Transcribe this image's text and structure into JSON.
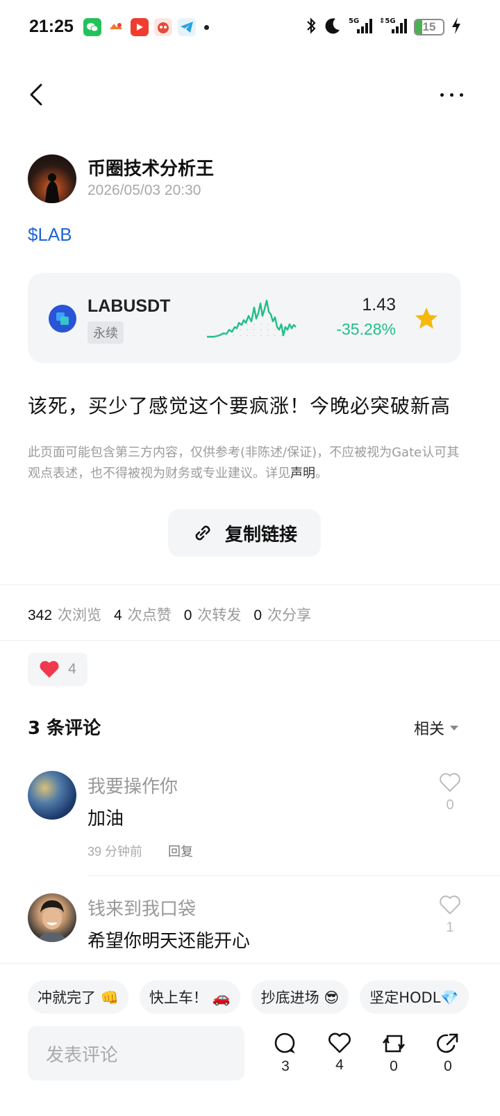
{
  "status_bar": {
    "time": "21:25",
    "battery": "15",
    "icons": [
      "wechat-icon",
      "game-icon",
      "video-app-icon",
      "shopping-app-icon",
      "telegram-icon",
      "notification-dot-icon",
      "bluetooth-icon",
      "moon-icon",
      "signal-5g-icon",
      "signal-5g-icon",
      "battery-icon",
      "charging-icon"
    ]
  },
  "header": {
    "back_icon": "chevron-left-icon",
    "more_icon": "more-dots-icon"
  },
  "post": {
    "author": "币圈技术分析王",
    "time": "2026/05/03 20:30",
    "ticker_tag": "$LAB",
    "text": "该死，买少了感觉这个要疯涨！今晚必突破新高"
  },
  "market_card": {
    "pair": "LABUSDT",
    "type": "永续",
    "price": "1.43",
    "change": "-35.28%",
    "change_color": "#1fbf86",
    "favorite": true
  },
  "disclaimer": {
    "text": "此页面可能包含第三方内容，仅供参考(非陈述/保证)，不应被视为Gate认可其观点表述，也不得被视为财务或专业建议。详见",
    "link": "声明",
    "tail": "。"
  },
  "copy_link": {
    "label": "复制链接",
    "icon": "link-icon"
  },
  "stats": {
    "views": "342",
    "views_label": "次浏览",
    "likes": "4",
    "likes_label": "次点赞",
    "reposts": "0",
    "reposts_label": "次转发",
    "shares": "0",
    "shares_label": "次分享"
  },
  "reaction": {
    "emoji": "heart",
    "count": "4"
  },
  "comments": {
    "title": "3 条评论",
    "sort": "相关",
    "items": [
      {
        "user": "我要操作你",
        "text": "加油",
        "time": "39 分钟前",
        "reply": "回复",
        "likes": "0"
      },
      {
        "user": "钱来到我口袋",
        "text": "希望你明天还能开心",
        "likes": "1"
      }
    ]
  },
  "bottom": {
    "chips": [
      "冲就完了 👊",
      "快上车！ 🚗",
      "抄底进场 😎",
      "坚定HODL💎"
    ],
    "input_placeholder": "发表评论",
    "comments_count": "3",
    "likes_count": "4",
    "reposts_count": "0",
    "shares_count": "0"
  }
}
